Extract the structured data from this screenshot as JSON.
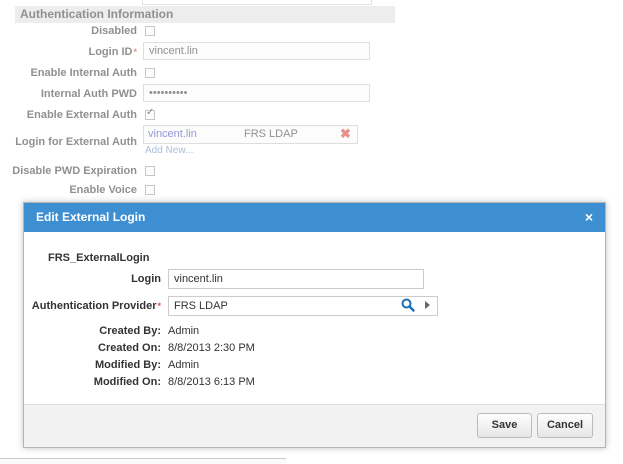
{
  "background_form": {
    "section_title": "Authentication Information",
    "fields": {
      "disabled": {
        "label": "Disabled",
        "checked": false
      },
      "login_id": {
        "label": "Login ID",
        "value": "vincent.lin"
      },
      "enable_internal_auth": {
        "label": "Enable Internal Auth",
        "checked": false
      },
      "internal_auth_pwd": {
        "label": "Internal Auth PWD",
        "value": "••••••••••"
      },
      "enable_external_auth": {
        "label": "Enable External Auth",
        "checked": true
      },
      "login_for_external_auth": {
        "label": "Login for External Auth",
        "entries": [
          {
            "login": "vincent.lin",
            "provider": "FRS LDAP"
          }
        ],
        "add_new": "Add New..."
      },
      "disable_pwd_expiration": {
        "label": "Disable PWD Expiration",
        "checked": false
      },
      "enable_voice": {
        "label": "Enable Voice",
        "checked": false
      }
    }
  },
  "dialog": {
    "title": "Edit External Login",
    "close_glyph": "×",
    "entity_name": "FRS_ExternalLogin",
    "login": {
      "label": "Login",
      "value": "vincent.lin"
    },
    "auth_provider": {
      "label": "Authentication Provider",
      "value": "FRS LDAP"
    },
    "created_by": {
      "label": "Created By:",
      "value": "Admin"
    },
    "created_on": {
      "label": "Created On:",
      "value": "8/8/2013 2:30 PM"
    },
    "modified_by": {
      "label": "Modified By:",
      "value": "Admin"
    },
    "modified_on": {
      "label": "Modified On:",
      "value": "8/8/2013 6:13 PM"
    },
    "buttons": {
      "save": "Save",
      "cancel": "Cancel"
    }
  },
  "colors": {
    "dialog_header": "#3d8fd1",
    "required_marker": "#d9534f",
    "link": "#7a9cc2"
  },
  "icons": {
    "delete": "close-icon",
    "lookup_search": "search-icon",
    "lookup_expand": "chevron-right-icon"
  }
}
